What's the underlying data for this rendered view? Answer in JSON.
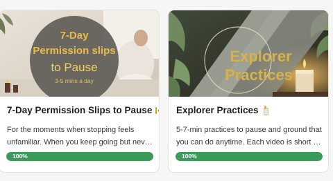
{
  "courses": [
    {
      "thumbnail": {
        "line1": "7-Day",
        "line2": "Permission slips",
        "line3": "to Pause",
        "line4": "3-5 mins a day"
      },
      "title": "7-Day Permission Slips to Pause",
      "title_icon": "ticket-icon",
      "description_line1": "For the moments when stopping feels",
      "description_line2": "unfamiliar. When you keep going but never...",
      "progress": 1.0,
      "progress_label": "100%"
    },
    {
      "thumbnail": {
        "line1": "Explorer",
        "line2": "Practices"
      },
      "title": "Explorer Practices",
      "title_icon": "candle-icon",
      "description_line1": "5-7-min practices to pause and ground that",
      "description_line2": "you can do anytime. Each video is short an...",
      "progress": 1.0,
      "progress_label": "100%"
    }
  ],
  "colors": {
    "progress_fill": "#3c9a5b",
    "progress_track": "#e2e2e2",
    "thumb_left_text": "#e7bd47",
    "thumb_right_text": "#d9b14a"
  }
}
